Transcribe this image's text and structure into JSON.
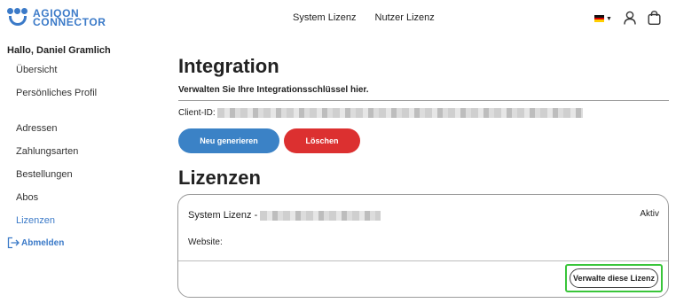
{
  "brand": {
    "line1": "AGIQON",
    "line2": "CONNECTOR",
    "color": "#3b7ac8"
  },
  "nav": {
    "items": [
      {
        "label": "System Lizenz"
      },
      {
        "label": "Nutzer Lizenz"
      }
    ]
  },
  "header_icons": {
    "flag": "german-flag-icon",
    "user": "user-icon",
    "cart": "shopping-bag-icon"
  },
  "sidebar": {
    "greeting": "Hallo, Daniel Gramlich",
    "items": [
      {
        "label": "Übersicht"
      },
      {
        "label": "Persönliches Profil"
      },
      {
        "label": "Adressen"
      },
      {
        "label": "Zahlungsarten"
      },
      {
        "label": "Bestellungen"
      },
      {
        "label": "Abos"
      },
      {
        "label": "Lizenzen"
      }
    ],
    "logout": "Abmelden"
  },
  "integration": {
    "title": "Integration",
    "subtitle": "Verwalten Sie Ihre Integrationsschlüssel hier.",
    "client_id_label": "Client-ID:",
    "regenerate_label": "Neu generieren",
    "delete_label": "Löschen"
  },
  "licenses": {
    "title": "Lizenzen",
    "card": {
      "name_prefix": "System Lizenz -",
      "status": "Aktiv",
      "website_label": "Website:",
      "manage_label": "Verwalte diese Lizenz"
    }
  },
  "colors": {
    "primary": "#3b82c6",
    "danger": "#dc3030",
    "highlight": "#39c53a"
  }
}
